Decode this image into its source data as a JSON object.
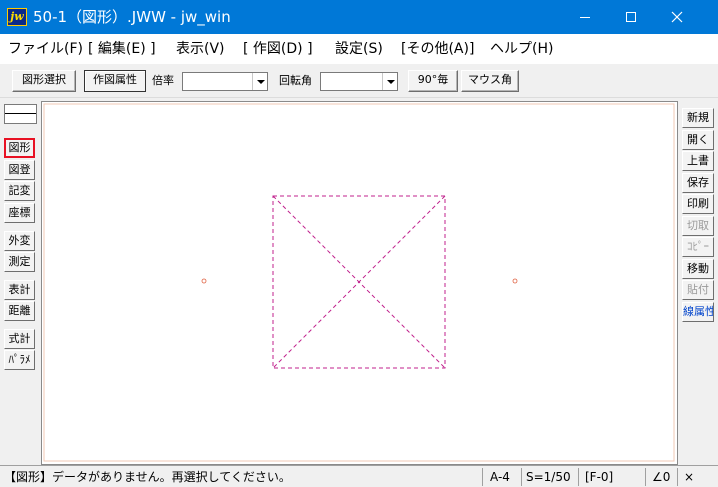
{
  "window": {
    "title": "50-1（図形）.JWW - jw_win",
    "icon_label": "jw",
    "controls": [
      "minimize-icon",
      "maximize-icon",
      "close-icon"
    ]
  },
  "menu": [
    "ファイル(F)",
    "[ 編集(E) ]",
    "表示(V)",
    "[ 作図(D) ]",
    "設定(S)",
    "[その他(A)]",
    "ヘルプ(H)"
  ],
  "toolbar": {
    "select_label": "図形選択",
    "attr_label": "作図属性",
    "scale_label": "倍率",
    "scale_value": "",
    "rotate_label": "回転角",
    "rotate_value": "",
    "angle90_label": "90°毎",
    "mouse_angle_label": "マウス角"
  },
  "left_tools": [
    "図形",
    "図登",
    "記変",
    "座標",
    "外変",
    "測定",
    "表計",
    "距離",
    "式計",
    "ﾊﾟﾗﾒ"
  ],
  "left_active": "図形",
  "right_tools": [
    "新規",
    "開く",
    "上書",
    "保存",
    "印刷",
    "切取",
    "ｺﾋﾟｰ",
    "移動",
    "貼付",
    "線属性"
  ],
  "right_disabled": [
    "切取",
    "ｺﾋﾟｰ",
    "貼付"
  ],
  "right_blue": [
    "線属性"
  ],
  "canvas": {
    "line_color": "#c0208c",
    "border_color": "#f0c8b4"
  },
  "status": {
    "message": "【図形】データがありません。再選択してください。",
    "paper": "A-4",
    "scale": "S=1/50",
    "layer": "[F-0]",
    "angle": "∠0",
    "close_mark": "×"
  }
}
